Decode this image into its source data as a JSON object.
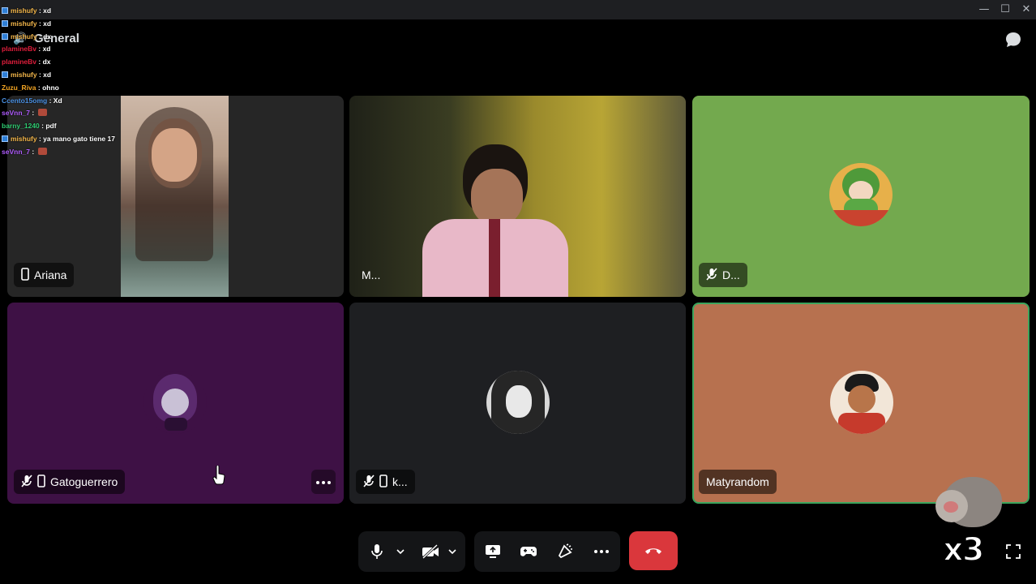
{
  "window": {
    "minimize": "—",
    "maximize": "☐",
    "close": "✕"
  },
  "channel": {
    "name": "General"
  },
  "chat": [
    {
      "user": "mishufy",
      "text": "xd",
      "color": "#f3b64a",
      "badge": true
    },
    {
      "user": "mishufy",
      "text": "xd",
      "color": "#f3b64a",
      "badge": true
    },
    {
      "user": "mishufy",
      "text": "dx",
      "color": "#f3b64a",
      "badge": true
    },
    {
      "user": "plamineBv",
      "text": "xd",
      "color": "#e01e3c",
      "badge": false
    },
    {
      "user": "plamineBv",
      "text": "dx",
      "color": "#e01e3c",
      "badge": false
    },
    {
      "user": "mishufy",
      "text": "xd",
      "color": "#f3b64a",
      "badge": true
    },
    {
      "user": "Zuzu_Riva",
      "text": "ohno",
      "color": "#f5a623",
      "badge": false
    },
    {
      "user": "Ccento15omg",
      "text": "Xd",
      "color": "#4a90e2",
      "badge": false
    },
    {
      "user": "seVnn_7",
      "text": "",
      "color": "#b05cff",
      "badge": false,
      "emote": true
    },
    {
      "user": "barny_1240",
      "text": "pdf",
      "color": "#2ecc71",
      "badge": false
    },
    {
      "user": "mishufy",
      "text": "ya mano gato tiene 17",
      "color": "#f3b64a",
      "badge": true
    },
    {
      "user": "seVnn_7",
      "text": "",
      "color": "#b05cff",
      "badge": false,
      "emote": true
    }
  ],
  "tiles": {
    "ariana": {
      "name": "Ariana"
    },
    "m": {
      "name": "M..."
    },
    "d": {
      "name": "D...",
      "bg": "#73a94e"
    },
    "gatoguerrero": {
      "name": "Gatoguerrero",
      "bg": "#3e1145"
    },
    "k": {
      "name": "k...",
      "bg": "#1e1f22"
    },
    "matyrandom": {
      "name": "Matyrandom",
      "bg": "#b7714f",
      "border": "#3ba55d"
    }
  },
  "controls": {
    "end_call_color": "#da373c"
  },
  "overlay": {
    "text": "x3"
  }
}
